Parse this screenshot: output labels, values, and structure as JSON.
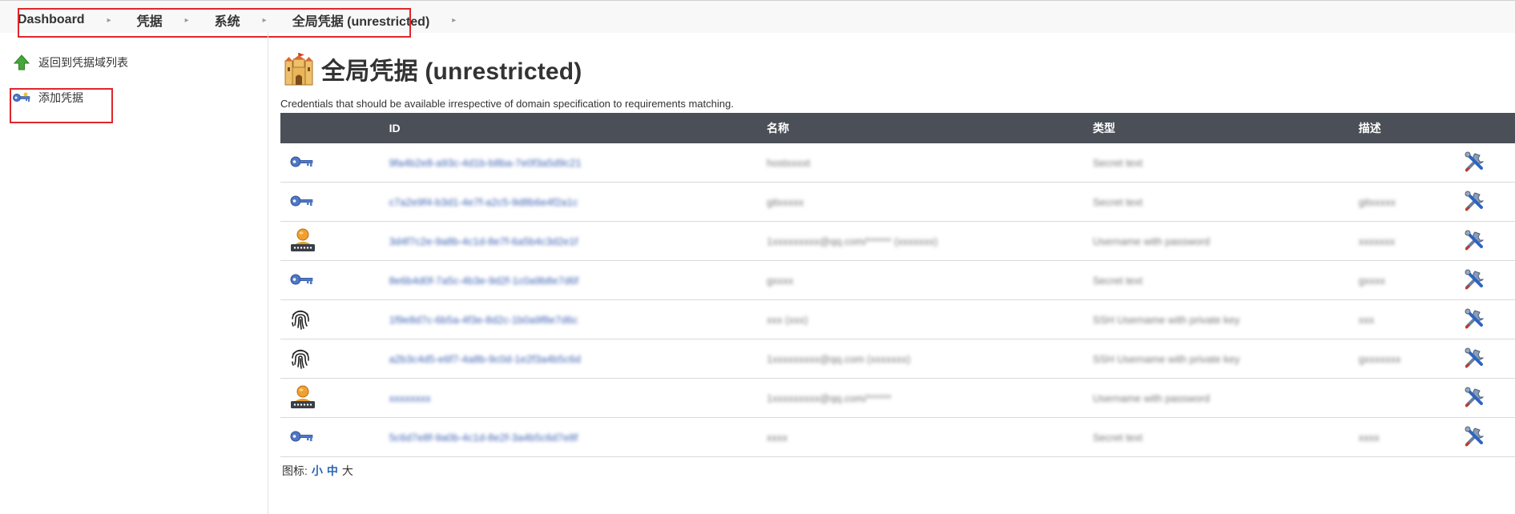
{
  "breadcrumb": {
    "items": [
      "Dashboard",
      "凭据",
      "系统",
      "全局凭据 (unrestricted)"
    ]
  },
  "sidebar": {
    "tasks": [
      {
        "label": "返回到凭据域列表",
        "icon": "up-arrow-icon"
      },
      {
        "label": "添加凭据",
        "icon": "key-icon"
      }
    ]
  },
  "main": {
    "title": "全局凭据 (unrestricted)",
    "title_icon": "castle-icon",
    "description": "Credentials that should be available irrespective of domain specification to requirements matching."
  },
  "table": {
    "headers": {
      "icon": "",
      "id": "ID",
      "name": "名称",
      "type": "类型",
      "description": "描述"
    },
    "rows": [
      {
        "icon": "key-icon",
        "id": "9fa4b2e8-a93c-4d1b-b8ba-7e0f3a5d9c21",
        "name": "hostxxxxt",
        "type": "Secret text",
        "description": ""
      },
      {
        "icon": "key-icon",
        "id": "c7a2e9f4-b3d1-4e7f-a2c5-9d8b6e4f2a1c",
        "name": "gitxxxxx",
        "type": "Secret text",
        "description": "gitxxxxx"
      },
      {
        "icon": "user-pass-icon",
        "id": "3d4f7c2e-9a8b-4c1d-8e7f-6a5b4c3d2e1f",
        "name": "1xxxxxxxxx@qq.com/****** (xxxxxxx)",
        "type": "Username with password",
        "description": "xxxxxxx"
      },
      {
        "icon": "key-icon",
        "id": "8e6b4d0f-7a5c-4b3e-9d2f-1c0a9b8e7d6f",
        "name": "gxxxx",
        "type": "Secret text",
        "description": "gxxxx"
      },
      {
        "icon": "fingerprint-icon",
        "id": "1f9e8d7c-6b5a-4f3e-8d2c-1b0a9f8e7d6c",
        "name": "xxx (xxx)",
        "type": "SSH Username with private key",
        "description": "xxx"
      },
      {
        "icon": "fingerprint-icon",
        "id": "a2b3c4d5-e6f7-4a8b-9c0d-1e2f3a4b5c6d",
        "name": "1xxxxxxxxx@qq.com (xxxxxxx)",
        "type": "SSH Username with private key",
        "description": "gxxxxxxx"
      },
      {
        "icon": "user-pass-icon",
        "id": "xxxxxxxx",
        "name": "1xxxxxxxxx@qq.com/******",
        "type": "Username with password",
        "description": ""
      },
      {
        "icon": "key-icon",
        "id": "5c6d7e8f-9a0b-4c1d-8e2f-3a4b5c6d7e8f",
        "name": "xxxx",
        "type": "Secret text",
        "description": "xxxx"
      }
    ]
  },
  "icon_size": {
    "label": "图标:",
    "options": [
      "小",
      "中",
      "大"
    ],
    "current": "大"
  },
  "colors": {
    "header_bg": "#4b4f58",
    "link": "#3f63b3",
    "annotation": "#e0262a"
  }
}
